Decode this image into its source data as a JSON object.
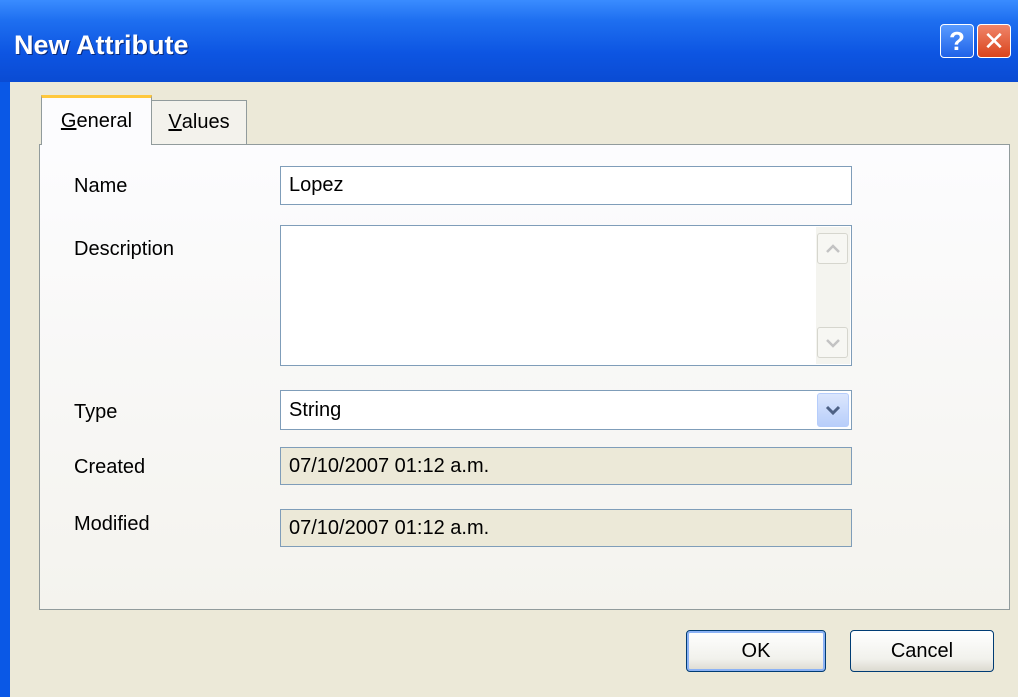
{
  "window": {
    "title": "New Attribute",
    "help_label": "?",
    "close_label": "✕"
  },
  "tabs": [
    {
      "label_mnemonic": "G",
      "label_rest": "eneral",
      "active": true
    },
    {
      "label_mnemonic": "V",
      "label_rest": "alues",
      "active": false
    }
  ],
  "form": {
    "name_label": "Name",
    "name_value": "Lopez",
    "description_label": "Description",
    "description_value": "",
    "type_label": "Type",
    "type_value": "String",
    "created_label": "Created",
    "created_value": "07/10/2007 01:12 a.m.",
    "modified_label": "Modified",
    "modified_value": "07/10/2007 01:12 a.m."
  },
  "buttons": {
    "ok_label": "OK",
    "cancel_label": "Cancel"
  },
  "colors": {
    "titlebar": "#0a58e6",
    "dialog_bg": "#ece9d8",
    "active_tab_highlight": "#ffc83c",
    "field_border": "#7f9db9"
  }
}
